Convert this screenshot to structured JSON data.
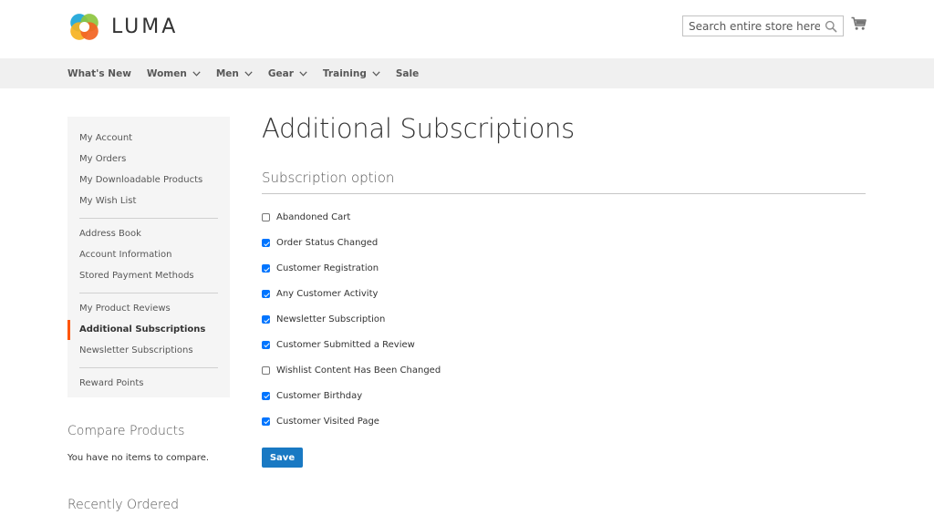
{
  "header": {
    "logo_text": "LUMA",
    "search_placeholder": "Search entire store here...",
    "colors": {
      "logo_orange": "#f26322",
      "logo_yellow": "#f6b221",
      "logo_green": "#8dc63f",
      "logo_blue": "#1ba5d8"
    }
  },
  "nav": {
    "items": [
      {
        "label": "What's New",
        "has_dropdown": false
      },
      {
        "label": "Women",
        "has_dropdown": true
      },
      {
        "label": "Men",
        "has_dropdown": true
      },
      {
        "label": "Gear",
        "has_dropdown": true
      },
      {
        "label": "Training",
        "has_dropdown": true
      },
      {
        "label": "Sale",
        "has_dropdown": false
      }
    ]
  },
  "sidebar": {
    "groups": [
      [
        "My Account",
        "My Orders",
        "My Downloadable Products",
        "My Wish List"
      ],
      [
        "Address Book",
        "Account Information",
        "Stored Payment Methods"
      ],
      [
        "My Product Reviews",
        "Additional Subscriptions",
        "Newsletter Subscriptions"
      ],
      [
        "Reward Points"
      ]
    ],
    "active": "Additional Subscriptions",
    "active_color": "#ff5501"
  },
  "compare": {
    "title": "Compare Products",
    "empty": "You have no items to compare."
  },
  "recent": {
    "title": "Recently Ordered"
  },
  "main": {
    "title": "Additional Subscriptions",
    "section_title": "Subscription option",
    "options": [
      {
        "label": "Abandoned Cart",
        "checked": false
      },
      {
        "label": "Order Status Changed",
        "checked": true
      },
      {
        "label": "Customer Registration",
        "checked": true
      },
      {
        "label": "Any Customer Activity",
        "checked": true
      },
      {
        "label": "Newsletter Subscription",
        "checked": true
      },
      {
        "label": "Customer Submitted a Review",
        "checked": true
      },
      {
        "label": "Wishlist Content Has Been Changed",
        "checked": false
      },
      {
        "label": "Customer Birthday",
        "checked": true
      },
      {
        "label": "Customer Visited Page",
        "checked": true
      }
    ],
    "save_label": "Save",
    "button_color": "#1979c3"
  }
}
